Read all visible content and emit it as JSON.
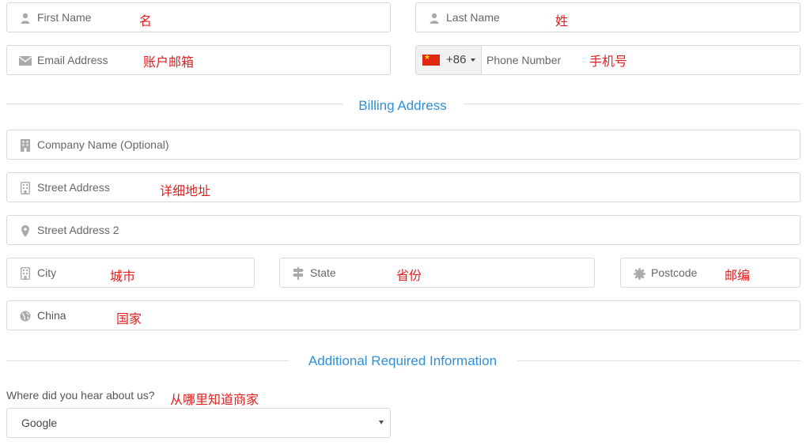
{
  "fields": {
    "first_name": {
      "placeholder": "First Name",
      "note": "名",
      "icon": "user-icon"
    },
    "last_name": {
      "placeholder": "Last Name",
      "note": "姓",
      "icon": "user-icon"
    },
    "email": {
      "placeholder": "Email Address",
      "note": "账户邮箱",
      "icon": "envelope-icon"
    },
    "phone": {
      "placeholder": "Phone Number",
      "note": "手机号",
      "country_code": "+86",
      "flag": "china-flag-icon"
    },
    "company": {
      "placeholder": "Company Name (Optional)",
      "icon": "building-icon"
    },
    "street": {
      "placeholder": "Street Address",
      "note": "详细地址",
      "icon": "building-icon"
    },
    "street2": {
      "placeholder": "Street Address 2",
      "icon": "map-marker-icon"
    },
    "city": {
      "placeholder": "City",
      "note": "城市",
      "icon": "building-icon"
    },
    "state": {
      "placeholder": "State",
      "note": "省份",
      "icon": "signpost-icon"
    },
    "postcode": {
      "placeholder": "Postcode",
      "note": "邮编",
      "icon": "certificate-icon"
    },
    "country": {
      "value": "China",
      "note": "国家",
      "icon": "globe-icon"
    }
  },
  "sections": {
    "billing": "Billing Address",
    "additional": "Additional Required Information"
  },
  "referral": {
    "question": "Where did you hear about us?",
    "note": "从哪里知道商家",
    "selected": "Google"
  },
  "colors": {
    "accent": "#2f8fd6",
    "note": "#e02020",
    "border": "#d9d9d9"
  }
}
